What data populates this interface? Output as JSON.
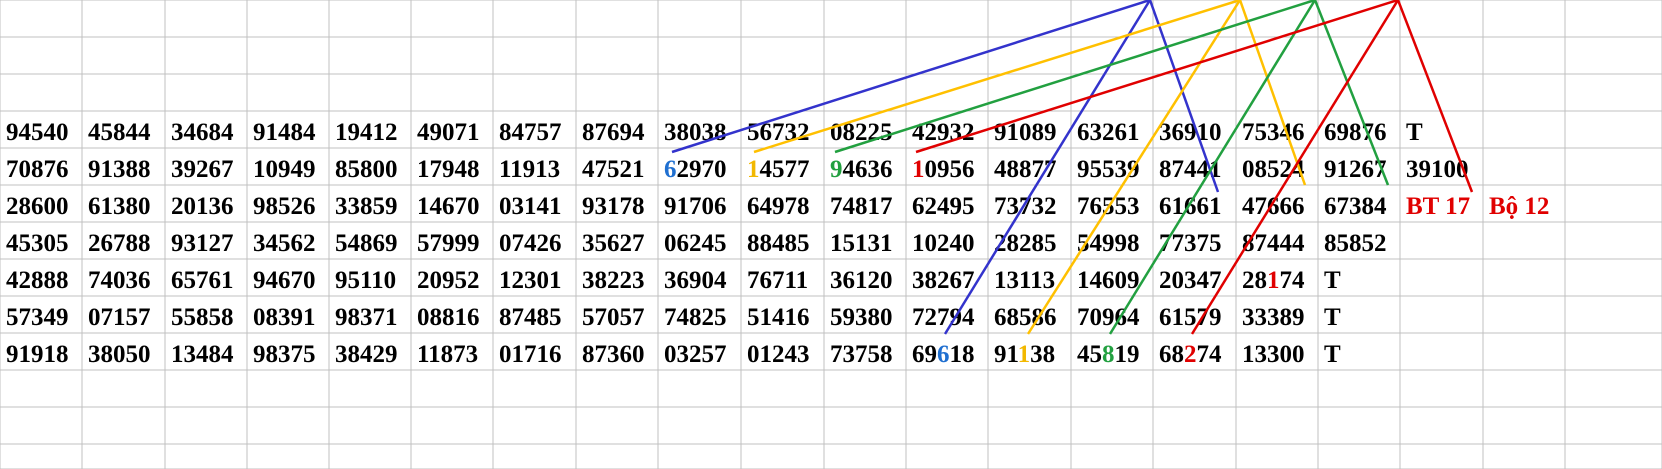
{
  "grid": {
    "row_labels": [],
    "rows": [
      [
        "94540",
        "45844",
        "34684",
        "91484",
        "19412",
        "49071",
        "84757",
        "87694",
        "38038",
        "56732",
        "08225",
        "42932",
        "91089",
        "63261",
        "36910",
        "75346",
        "69876",
        "T",
        "",
        ""
      ],
      [
        "70876",
        "91388",
        "39267",
        "10949",
        "85800",
        "17948",
        "11913",
        "47521",
        "62970",
        "14577",
        "94636",
        "10956",
        "48877",
        "95539",
        "87441",
        "08524",
        "91267",
        "39100",
        "",
        ""
      ],
      [
        "28600",
        "61380",
        "20136",
        "98526",
        "33859",
        "14670",
        "03141",
        "93178",
        "91706",
        "64978",
        "74817",
        "62495",
        "73732",
        "76553",
        "61661",
        "47666",
        "67384",
        "BT 17",
        "Bộ 12",
        ""
      ],
      [
        "45305",
        "26788",
        "93127",
        "34562",
        "54869",
        "57999",
        "07426",
        "35627",
        "06245",
        "88485",
        "15131",
        "10240",
        "28285",
        "54998",
        "77375",
        "87444",
        "85852",
        "",
        "",
        ""
      ],
      [
        "42888",
        "74036",
        "65761",
        "94670",
        "95110",
        "20952",
        "12301",
        "38223",
        "36904",
        "76711",
        "36120",
        "38267",
        "13113",
        "14609",
        "20347",
        "28174",
        "T",
        "",
        "",
        ""
      ],
      [
        "57349",
        "07157",
        "55858",
        "08391",
        "98371",
        "08816",
        "87485",
        "57057",
        "74825",
        "51416",
        "59380",
        "72794",
        "68586",
        "70964",
        "61579",
        "33389",
        "T",
        "",
        "",
        ""
      ],
      [
        "91918",
        "38050",
        "13484",
        "98375",
        "38429",
        "11873",
        "01716",
        "87360",
        "03257",
        "01243",
        "73758",
        "69618",
        "91138",
        "45819",
        "68274",
        "13300",
        "T",
        "",
        "",
        ""
      ]
    ],
    "highlights": [
      {
        "row": 1,
        "col": 8,
        "pos": 0,
        "color": "#1f6fd0"
      },
      {
        "row": 1,
        "col": 9,
        "pos": 0,
        "color": "#f2b800"
      },
      {
        "row": 1,
        "col": 10,
        "pos": 0,
        "color": "#22a040"
      },
      {
        "row": 1,
        "col": 11,
        "pos": 0,
        "color": "#e00000"
      },
      {
        "row": 4,
        "col": 15,
        "pos": 2,
        "color": "#e00000"
      },
      {
        "row": 6,
        "col": 11,
        "pos": 2,
        "color": "#1f6fd0"
      },
      {
        "row": 6,
        "col": 12,
        "pos": 2,
        "color": "#f2b800"
      },
      {
        "row": 6,
        "col": 13,
        "pos": 2,
        "color": "#22a040"
      },
      {
        "row": 6,
        "col": 14,
        "pos": 2,
        "color": "#e00000"
      }
    ],
    "red_cells": [
      {
        "row": 2,
        "col": 17
      },
      {
        "row": 2,
        "col": 18
      }
    ],
    "colors": {
      "text": "#000000",
      "label_red": "#e00000",
      "blue_line": "#3333cc",
      "yellow_line": "#ffc000",
      "green_line": "#22a040",
      "red_line": "#e00000",
      "gridline": "#c0c0c0"
    }
  }
}
